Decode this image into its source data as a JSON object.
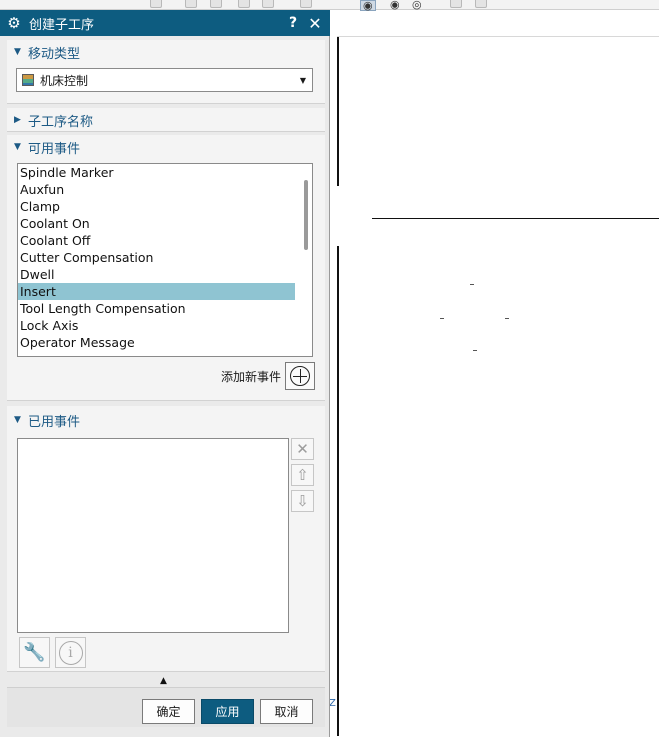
{
  "dialog": {
    "title": "创建子工序",
    "help_label": "?",
    "close_label": "✕"
  },
  "sections": {
    "move_type": {
      "label": "移动类型",
      "selected": "机床控制"
    },
    "sub_op_name": {
      "label": "子工序名称"
    },
    "available_events": {
      "label": "可用事件",
      "items": [
        "Spindle Marker",
        "Auxfun",
        "Clamp",
        "Coolant On",
        "Coolant Off",
        "Cutter Compensation",
        "Dwell",
        "Insert",
        "Tool Length Compensation",
        "Lock Axis",
        "Operator Message"
      ],
      "selected_index": 7,
      "add_label": "添加新事件"
    },
    "used_events": {
      "label": "已用事件"
    }
  },
  "footer": {
    "ok_label": "确定",
    "apply_label": "应用",
    "cancel_label": "取消"
  },
  "background": {
    "axis_label": "Z"
  },
  "colors": {
    "titlebar": "#0d5c80",
    "section_header": "#1d5a85",
    "selection": "#8fc4d2"
  }
}
